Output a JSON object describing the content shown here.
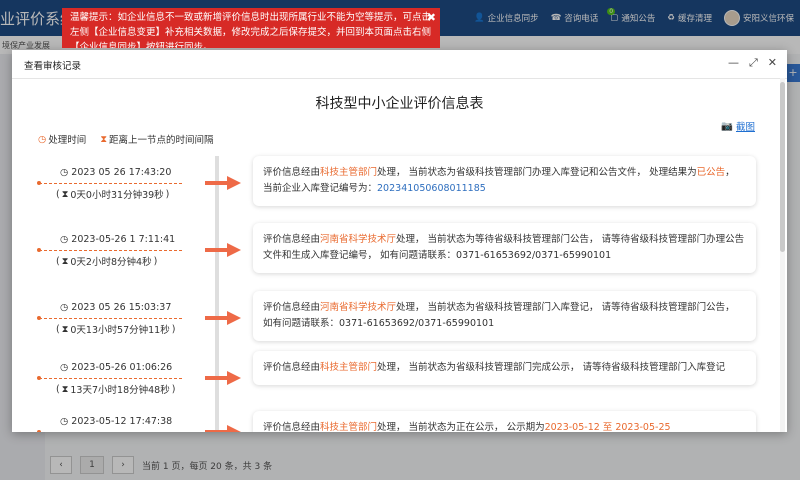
{
  "app": {
    "title": "业评价系统",
    "nav": [
      {
        "icon": "user-icon",
        "label": "企业信息同步"
      },
      {
        "icon": "phone-icon",
        "label": "咨询电话"
      },
      {
        "icon": "bell-icon",
        "label": "通知公告",
        "badge": "0"
      },
      {
        "icon": "recycle-icon",
        "label": "缓存清理"
      },
      {
        "icon": "avatar",
        "label": "安阳义信环保"
      }
    ],
    "subtab": "境保产业发展",
    "plus": "+"
  },
  "warning": {
    "text": "温馨提示：如企业信息不一致或新增评价信息时出现所属行业不能为空等提示，可点击左侧【企业信息变更】补充相关数据，修改完成之后保存提交，并回到本页面点击右侧【企业信息同步】按钮进行同步。",
    "close": "✖"
  },
  "modal": {
    "title": "查看审核记录",
    "doc_title": "科技型中小企业评价信息表",
    "screenshot_label": "截图",
    "legend": {
      "process_time": "处理时间",
      "interval": "距离上一节点的时间间隔"
    },
    "entries": [
      {
        "time": "2023 05 26 17:43:20",
        "duration": "0天0小时31分钟39秒",
        "p1": "评价信息经由",
        "org": "科技主管部门",
        "p2": "处理，  当前状态为省级科技管理部门办理入库登记和公告文件，  处理结果为",
        "status": "已公告",
        "p3": "，  当前企业入库登记编号为：",
        "code": "202341050608011185"
      },
      {
        "time": "2023-05-26 1 7:11:41",
        "duration": "0天2小时8分钟4秒",
        "p1": "评价信息经由",
        "org": "河南省科学技术厅",
        "p2": "处理，  当前状态为等待省级科技管理部门公告，  请等待省级科技管理部门办理公告文件和生成入库登记编号，  如有问题请联系：0371-61653692/0371-65990101"
      },
      {
        "time": "2023 05 26 15:03:37",
        "duration": "0天13小时57分钟11秒",
        "p1": "评价信息经由",
        "org": "河南省科学技术厅",
        "p2": "处理，  当前状态为省级科技管理部门入库登记，  请等待省级科技管理部门公告，  如有问题请联系：0371-61653692/0371-65990101"
      },
      {
        "time": "2023-05-26 01:06:26",
        "duration": "13天7小时18分钟48秒",
        "p1": "评价信息经由",
        "org": "科技主管部门",
        "p2": "处理，  当前状态为省级科技管理部门完成公示，  请等待省级科技管理部门入库登记"
      },
      {
        "time": "2023-05-12 17:47:38",
        "duration": "",
        "p1": "评价信息经由",
        "org": "科技主管部门",
        "p2": "处理，  当前状态为正在公示，  公示期为",
        "status": "2023-05-12 至 2023-05-25"
      }
    ]
  },
  "pager": {
    "prev": "‹",
    "page": "1",
    "next": "›",
    "summary": "当前  1  页，每页  20  条，共 3 条"
  },
  "colors": {
    "topbar": "#1e4b84",
    "warning": "#d72a26",
    "accent": "#e96a2f",
    "link": "#2f6fbf"
  }
}
